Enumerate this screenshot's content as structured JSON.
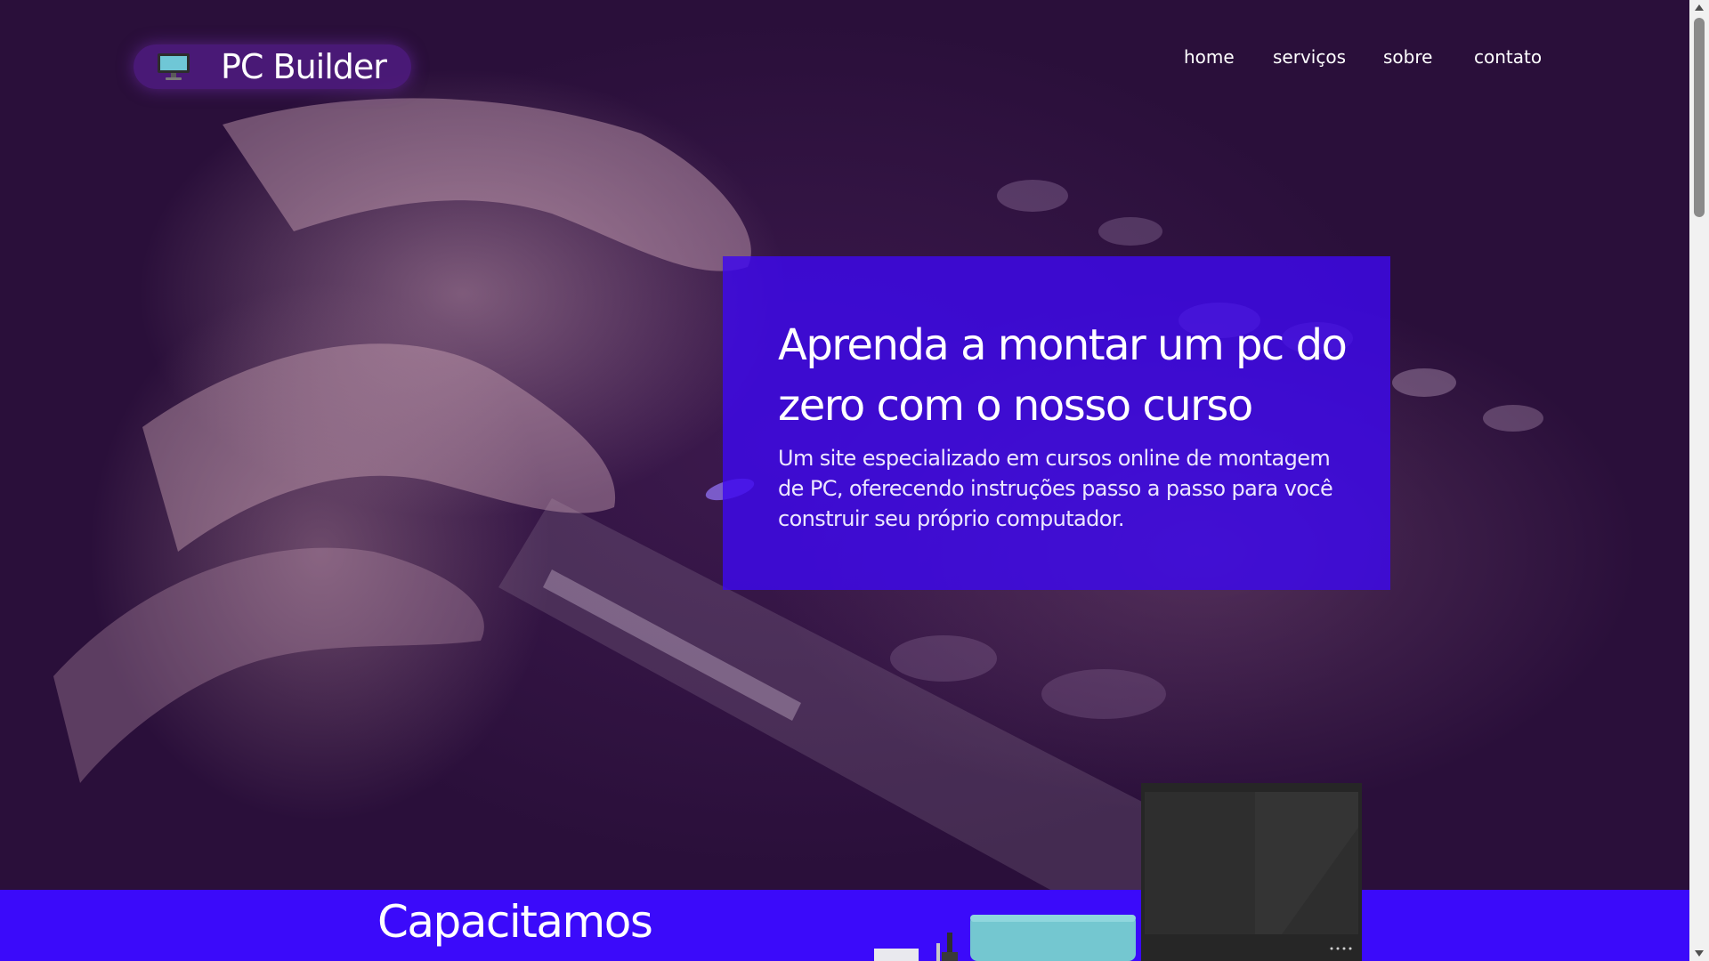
{
  "brand": {
    "name": "PC Builder",
    "icon": "monitor-icon"
  },
  "nav": {
    "items": [
      {
        "label": "home"
      },
      {
        "label": "serviços"
      },
      {
        "label": "sobre"
      },
      {
        "label": "contato"
      }
    ]
  },
  "hero": {
    "title": "Aprenda a montar um pc do zero com o nosso curso",
    "description": "Um site especializado em cursos online de montagem de PC, oferecendo instruções passo a passo para você construir seu próprio computador."
  },
  "section": {
    "title": "Capacitamos",
    "illustration": "computer-setup-illustration"
  },
  "colors": {
    "accent": "#3b0afa",
    "hero_card": "#3e08ee",
    "background": "#2a0f3a",
    "text": "#ffffff"
  }
}
